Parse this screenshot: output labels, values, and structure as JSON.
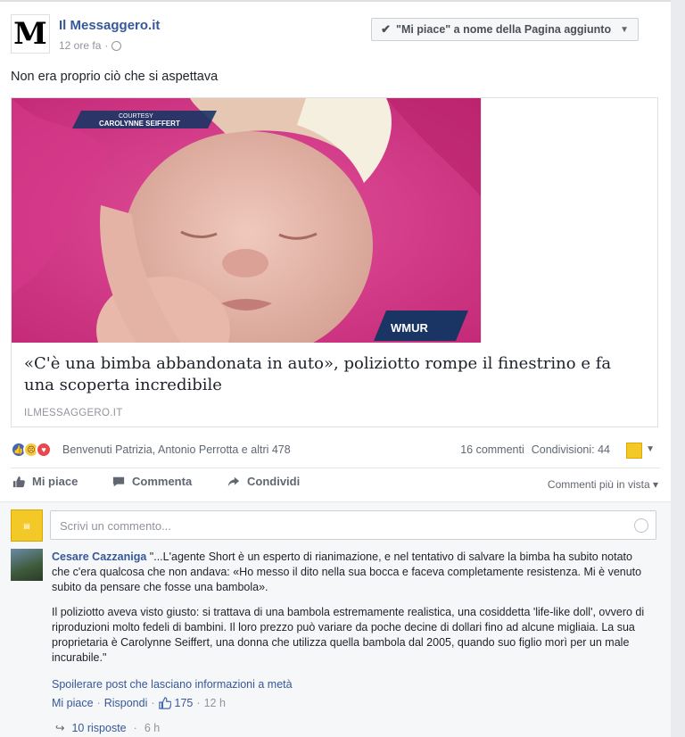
{
  "post": {
    "page_name": "Il Messaggero.it",
    "time": "12 ore fa",
    "like_page_button": "\"Mi piace\" a nome della Pagina aggiunto",
    "text": "Non era proprio ciò che si aspettava"
  },
  "link_card": {
    "image_overlay_top": "COURTESY",
    "image_overlay_name": "CAROLYNNE SEIFFERT",
    "image_logo": "WMUR",
    "title": "«C'è una bimba abbandonata in auto», poliziotto rompe il finestrino e fa una scoperta incredibile",
    "domain": "ILMESSAGGERO.IT"
  },
  "reactions": {
    "names": "Benvenuti Patrizia, Antonio Perrotta e altri 478",
    "comments_count": "16 commenti",
    "shares_count": "Condivisioni: 44"
  },
  "actions": {
    "like": "Mi piace",
    "comment": "Commenta",
    "share": "Condividi",
    "sort": "Commenti più in vista"
  },
  "comment_input": {
    "placeholder": "Scrivi un commento..."
  },
  "comment": {
    "author": "Cesare Cazzaniga",
    "paragraph1": "\"...L'agente Short è un esperto di rianimazione, e nel tentativo di salvare la bimba ha subito notato che c'era qualcosa che non andava: «Ho messo il dito nella sua bocca e faceva completamente resistenza. Mi è venuto subito da pensare che fosse una bambola».",
    "paragraph2": "Il poliziotto aveva visto giusto: si trattava di una bambola estremamente realistica, una cosiddetta 'life-like doll', ovvero di riproduzioni molto fedeli di bambini. Il loro prezzo può variare da poche decine di dollari fino ad alcune migliaia. La sua proprietaria è Carolynne Seiffert, una donna che utilizza quella bambola dal 2005, quando suo figlio morì per un male incurabile.\"",
    "attached_link": "Spoilerare post che lasciano informazioni a metà",
    "like": "Mi piace",
    "sep1": "·",
    "reply": "Rispondi",
    "sep2": "·",
    "like_count": "175",
    "sep3": "·",
    "time": "12 h",
    "replies": "10 risposte",
    "replies_sep": "·",
    "replies_time": "6 h"
  }
}
